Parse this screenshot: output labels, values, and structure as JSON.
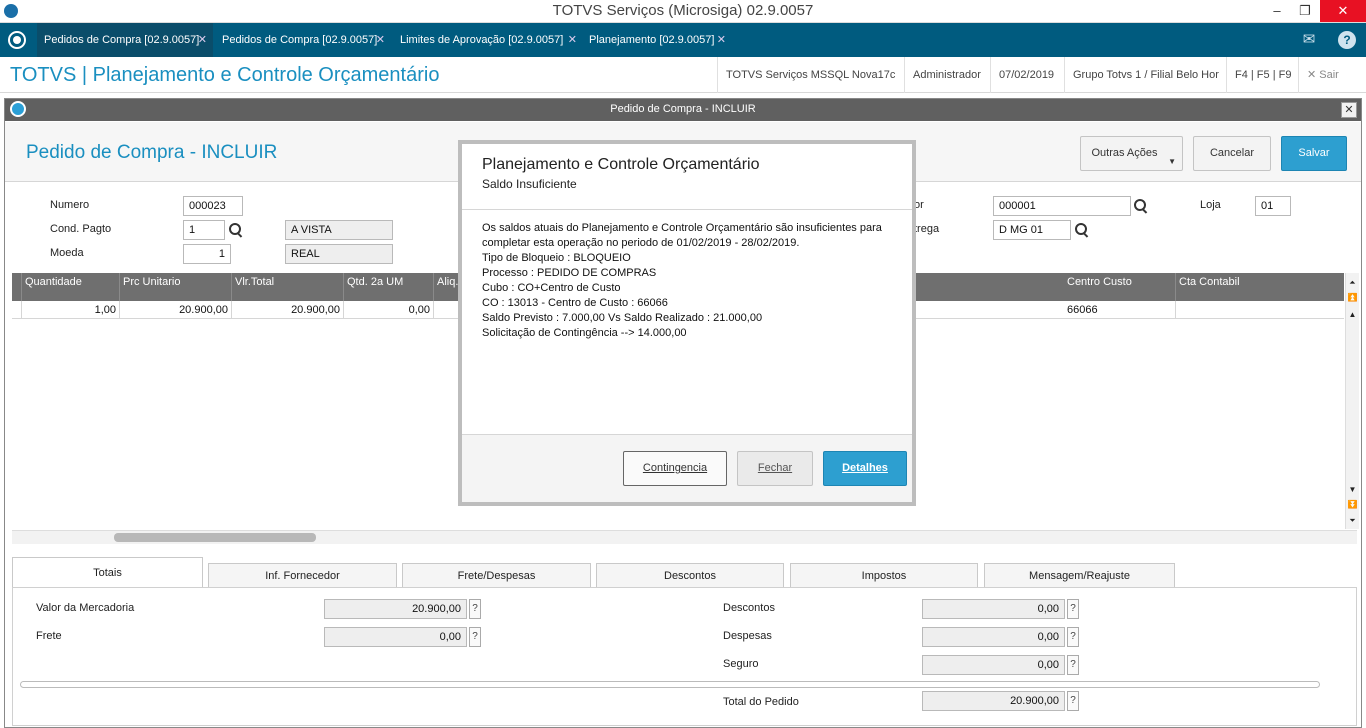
{
  "os": {
    "window_title": "TOTVS Serviços (Microsiga) 02.9.0057",
    "minimize": "–",
    "maximize": "❐",
    "close": "✕"
  },
  "tabs": [
    {
      "label": "Pedidos de Compra [02.9.0057]"
    },
    {
      "label": "Pedidos de Compra [02.9.0057]"
    },
    {
      "label": "Limites de Aprovação [02.9.0057]"
    },
    {
      "label": "Planejamento [02.9.0057]"
    }
  ],
  "tab_close": "✕",
  "header": {
    "title": "TOTVS | Planejamento e Controle Orçamentário",
    "env": "TOTVS Serviços MSSQL Nova17c",
    "user": "Administrador",
    "date": "07/02/2019",
    "branch": "Grupo Totvs 1 / Filial Belo Hor",
    "shortcuts": "F4 | F5 | F9",
    "exit": "Sair"
  },
  "window": {
    "bar_title": "Pedido de Compra - INCLUIR",
    "close": "✕",
    "page_title": "Pedido de Compra - INCLUIR",
    "actions": {
      "more": "Outras Ações",
      "cancel": "Cancelar",
      "save": "Salvar"
    }
  },
  "form": {
    "numero_label": "Numero",
    "numero": "000023",
    "cond_label": "Cond. Pagto",
    "cond": "1",
    "cond_desc": "A VISTA",
    "moeda_label": "Moeda",
    "moeda": "1",
    "moeda_desc": "REAL",
    "fornecedor_label": "or",
    "fornecedor": "000001",
    "loja_label": "Loja",
    "loja": "01",
    "entrega_label": "trega",
    "entrega": "D MG 01"
  },
  "grid": {
    "headers": {
      "qtd": "Quantidade",
      "prc": "Prc Unitario",
      "vlr": "Vlr.Total",
      "qtd2": "Qtd. 2a UM",
      "aliq": "Aliq.",
      "cc": "Centro Custo",
      "ctb": "Cta Contabil"
    },
    "row": {
      "qtd": "1,00",
      "prc": "20.900,00",
      "vlr": "20.900,00",
      "qtd2": "0,00",
      "cc": "66066"
    }
  },
  "bottom_tabs": [
    "Totais",
    "Inf. Fornecedor",
    "Frete/Despesas",
    "Descontos",
    "Impostos",
    "Mensagem/Reajuste"
  ],
  "totais": {
    "mercadoria_label": "Valor da Mercadoria",
    "mercadoria": "20.900,00",
    "frete_label": "Frete",
    "frete": "0,00",
    "descontos_label": "Descontos",
    "descontos": "0,00",
    "despesas_label": "Despesas",
    "despesas": "0,00",
    "seguro_label": "Seguro",
    "seguro": "0,00",
    "total_label": "Total do Pedido",
    "total": "20.900,00",
    "help": "?"
  },
  "modal": {
    "title": "Planejamento e Controle Orçamentário",
    "subtitle": "Saldo Insuficiente",
    "lines": [
      "Os saldos atuais do Planejamento e Controle Orçamentário são insuficientes para",
      "completar esta operação no periodo de 01/02/2019 - 28/02/2019.",
      "Tipo de Bloqueio : BLOQUEIO",
      "Processo : PEDIDO DE COMPRAS",
      "Cubo : CO+Centro de Custo",
      "CO : 13013 - Centro de Custo : 66066",
      "Saldo Previsto : 7.000,00 Vs Saldo Realizado : 21.000,00",
      "Solicitação de Contingência --> 14.000,00"
    ],
    "buttons": {
      "contingencia": "Contingencia",
      "fechar": "Fechar",
      "detalhes": "Detalhes"
    }
  },
  "colors": {
    "tabbar": "#005b7f",
    "accent": "#1a8fc0",
    "primary_button": "#2d9fd0"
  },
  "icons": [
    "app-icon",
    "totvs-logo-icon",
    "mail-icon",
    "help-icon",
    "close-icon",
    "search-icon",
    "dropdown-arrow-icon"
  ]
}
